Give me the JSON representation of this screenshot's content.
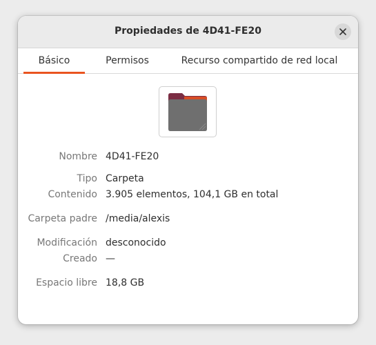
{
  "window": {
    "title": "Propiedades de 4D41-FE20",
    "close_icon": "close-icon"
  },
  "tabs": [
    {
      "label": "Básico",
      "active": true
    },
    {
      "label": "Permisos",
      "active": false
    },
    {
      "label": "Recurso compartido de red local",
      "active": false
    }
  ],
  "icon": {
    "name": "folder-icon",
    "colors": {
      "back": "#7b2d43",
      "front": "#6f6f6f",
      "accent": "#e95420"
    }
  },
  "properties": {
    "nombre": {
      "label": "Nombre",
      "value": "4D41-FE20"
    },
    "tipo": {
      "label": "Tipo",
      "value": "Carpeta"
    },
    "contenido": {
      "label": "Contenido",
      "value": "3.905 elementos, 104,1 GB en total"
    },
    "carpeta_padre": {
      "label": "Carpeta padre",
      "value": "/media/alexis"
    },
    "modificacion": {
      "label": "Modificación",
      "value": "desconocido"
    },
    "creado": {
      "label": "Creado",
      "value": "—"
    },
    "espacio_libre": {
      "label": "Espacio libre",
      "value": "18,8 GB"
    }
  },
  "colors": {
    "accent": "#e95420",
    "titlebar": "#ebebeb",
    "label_text": "#777777",
    "value_text": "#2e2e2e"
  }
}
